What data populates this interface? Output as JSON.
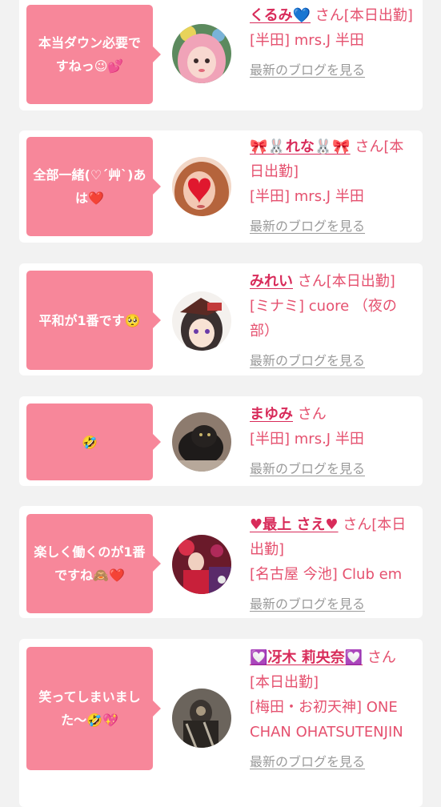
{
  "cards": [
    {
      "bubble": "本当ダウン必要ですねっ😉💕",
      "name": "くるみ💙",
      "suffix": "さん[本日出勤]",
      "shop": "[半田] mrs.J 半田",
      "blog_link": "最新のブログを見る",
      "avatar_icon": "avatar-pink-hair-girl"
    },
    {
      "bubble": "全部一緒(♡´艸`)あは❤️",
      "name": "🎀🐰れな🐰🎀",
      "suffix": "さん[本日出勤]",
      "shop": "[半田] mrs.J 半田",
      "blog_link": "最新のブログを見る",
      "avatar_icon": "avatar-heart-face"
    },
    {
      "bubble": "平和が1番です🥺",
      "name": "みれい",
      "suffix": "さん[本日出勤]",
      "shop": "[ミナミ] cuore （夜の部）",
      "blog_link": "最新のブログを見る",
      "avatar_icon": "avatar-anime-girl"
    },
    {
      "bubble": "🤣",
      "name": "まゆみ",
      "suffix": "さん",
      "shop": "[半田] mrs.J 半田",
      "blog_link": "最新のブログを見る",
      "avatar_icon": "avatar-black-cat"
    },
    {
      "bubble": "楽しく働くのが1番ですね🙈❤️",
      "name": "♥最上 さえ♥",
      "suffix": "さん[本日出勤]",
      "shop": "[名古屋 今池] Club em",
      "blog_link": "最新のブログを見る",
      "avatar_icon": "avatar-red-kimono"
    },
    {
      "bubble": "笑ってしまいました〜🤣💖",
      "name": "💟冴木 莉央奈💟",
      "suffix": "さん[本日出勤]",
      "shop": "[梅田・お初天神] ONE CHAN OHATSUTENJIN",
      "blog_link": "最新のブログを見る",
      "avatar_icon": "avatar-dark-costume"
    }
  ],
  "colors": {
    "bubble": "#f7879a",
    "name": "#d82b5a",
    "text": "#e5516f",
    "link": "#9a9a9a",
    "background": "#f2f2f2"
  }
}
